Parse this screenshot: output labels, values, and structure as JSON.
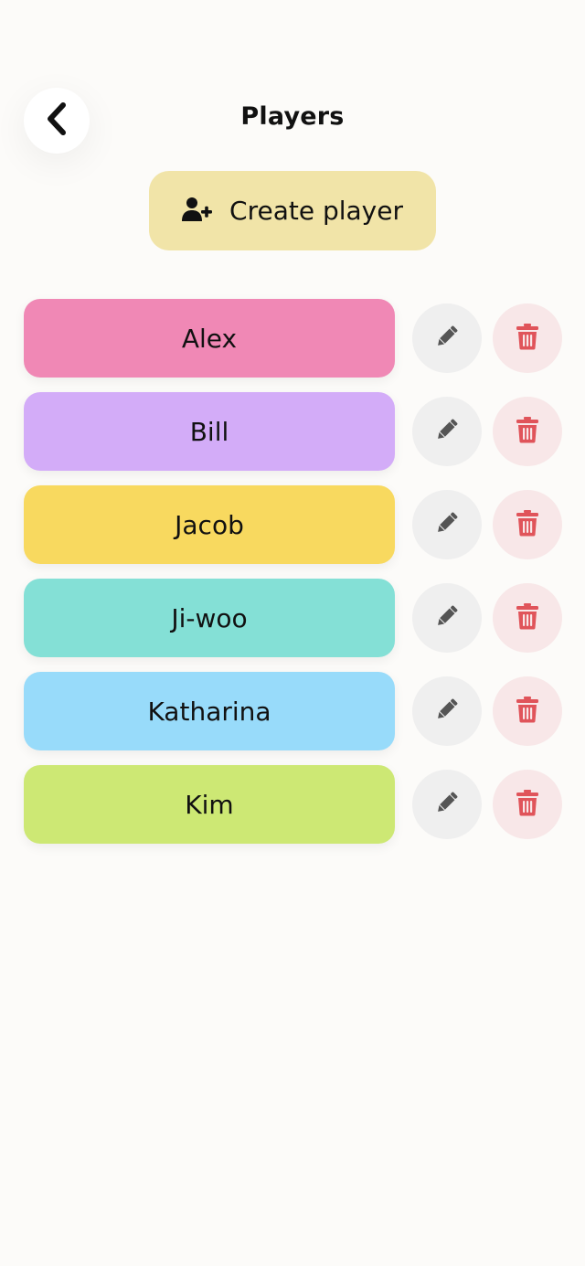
{
  "header": {
    "title": "Players",
    "back_icon": "chevron-left-icon"
  },
  "create_button": {
    "label": "Create player",
    "icon": "user-plus-icon",
    "color": "#f1e4a8"
  },
  "players": [
    {
      "name": "Alex",
      "color": "#f088b5"
    },
    {
      "name": "Bill",
      "color": "#d3acf8"
    },
    {
      "name": "Jacob",
      "color": "#f8d95f"
    },
    {
      "name": "Ji-woo",
      "color": "#84e0d6"
    },
    {
      "name": "Katharina",
      "color": "#98dbfa"
    },
    {
      "name": "Kim",
      "color": "#cde874"
    }
  ],
  "row_actions": {
    "edit_icon": "pencil-icon",
    "delete_icon": "trash-icon",
    "edit_bg": "#efefef",
    "delete_bg": "#f8e7e8",
    "delete_color": "#e0545a"
  }
}
